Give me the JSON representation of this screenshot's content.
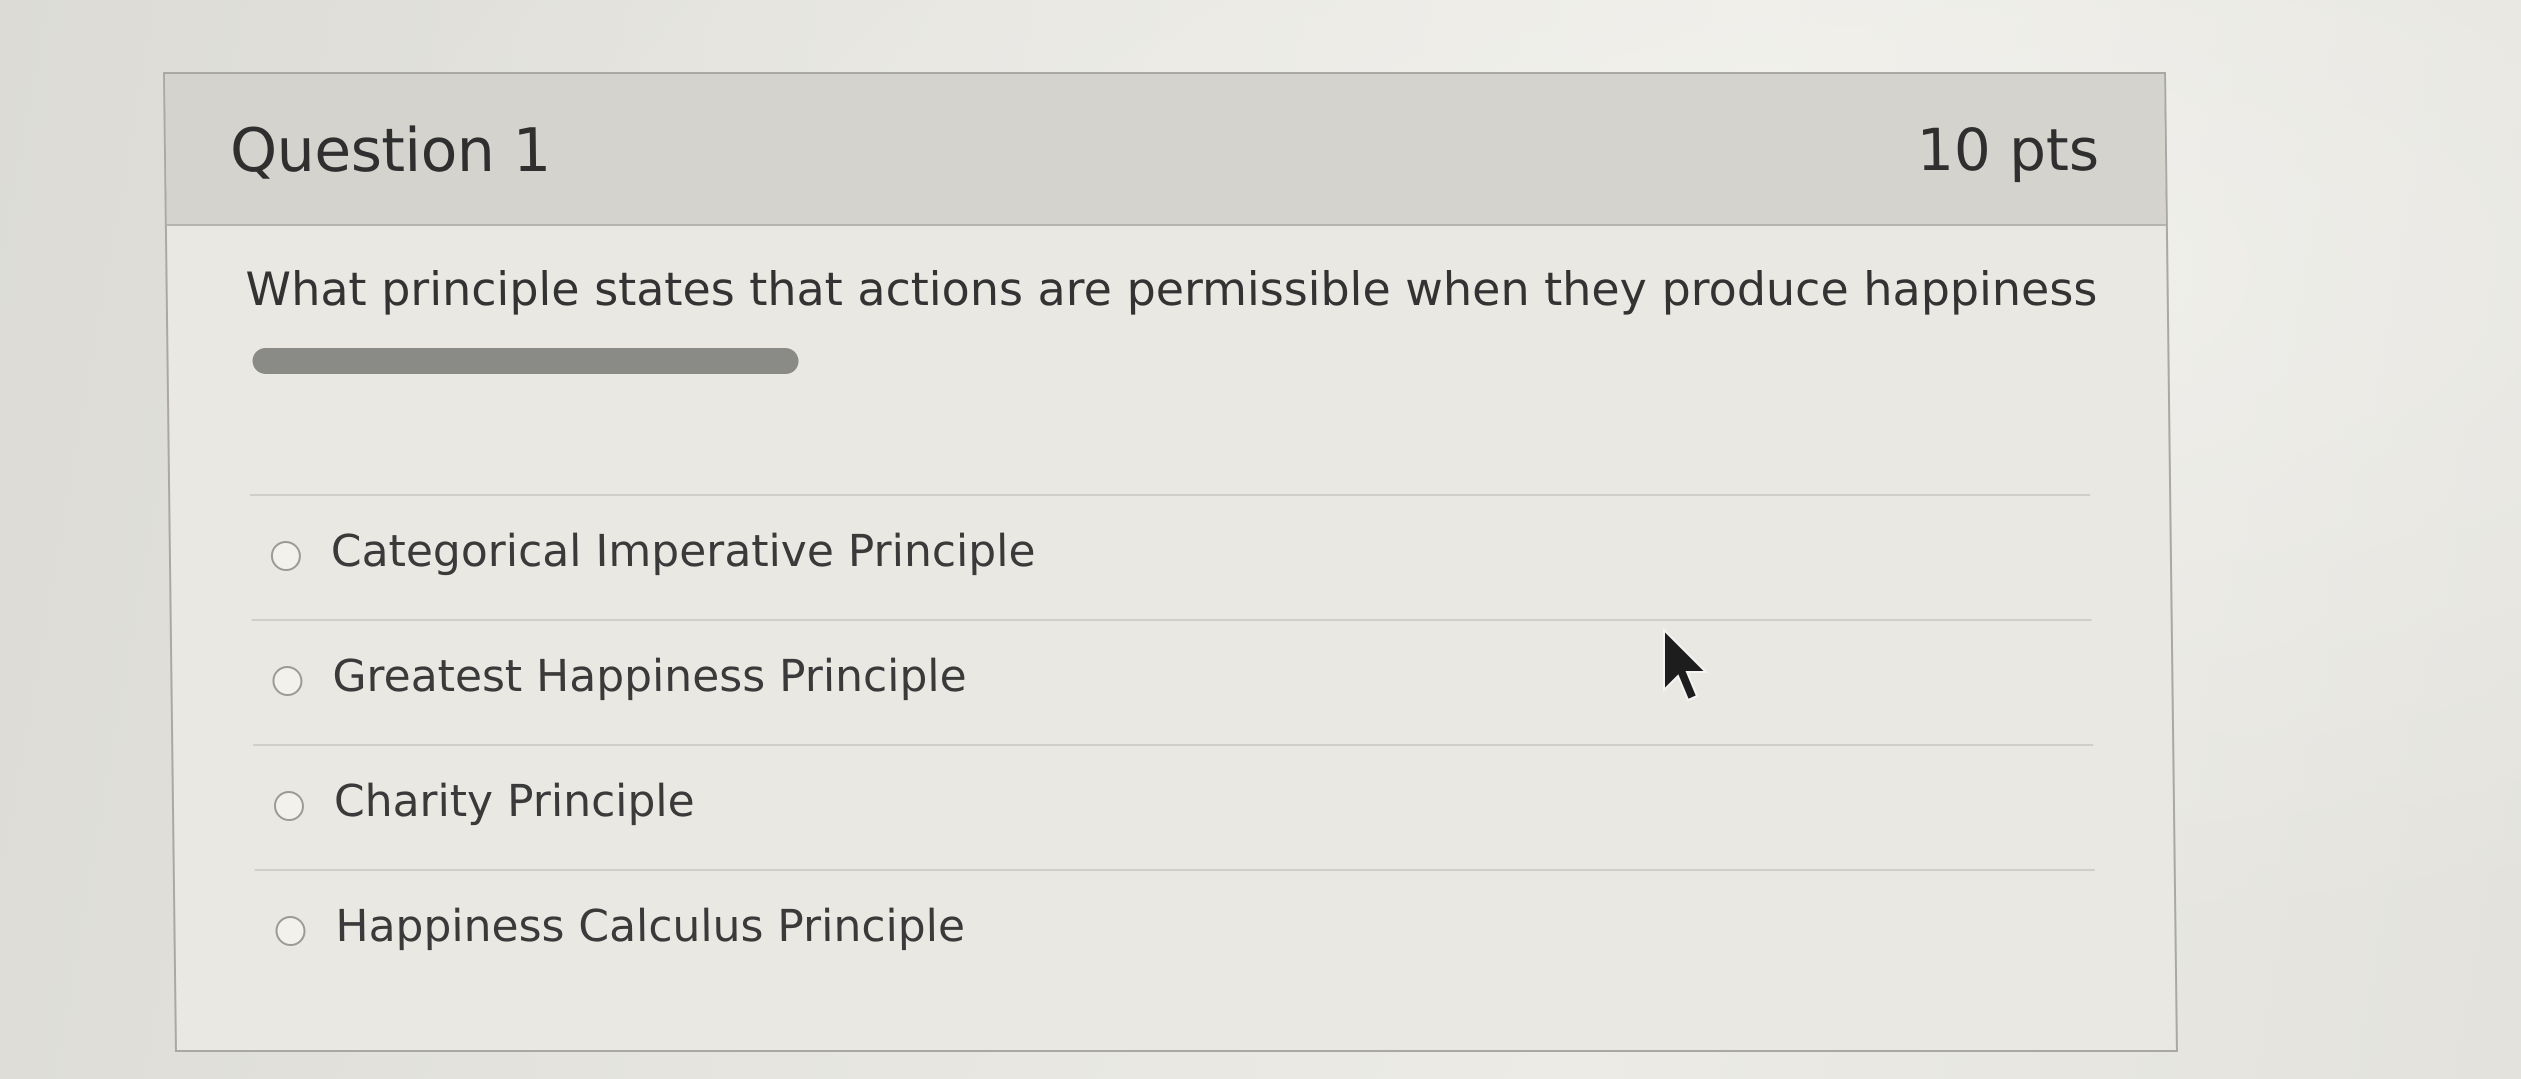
{
  "question": {
    "title": "Question 1",
    "points": "10 pts",
    "text": "What principle states that actions are permissible when they produce happiness"
  },
  "answers": [
    {
      "label": "Categorical Imperative Principle",
      "selected": false
    },
    {
      "label": "Greatest Happiness Principle",
      "selected": false
    },
    {
      "label": "Charity Principle",
      "selected": false
    },
    {
      "label": "Happiness Calculus Principle",
      "selected": false
    }
  ],
  "icons": {
    "cursor": "mouse-pointer-icon",
    "radio": "radio-unselected-icon"
  },
  "colors": {
    "header_background": "#d4d3cd",
    "card_background": "#e9e8e2",
    "text": "#333333"
  }
}
